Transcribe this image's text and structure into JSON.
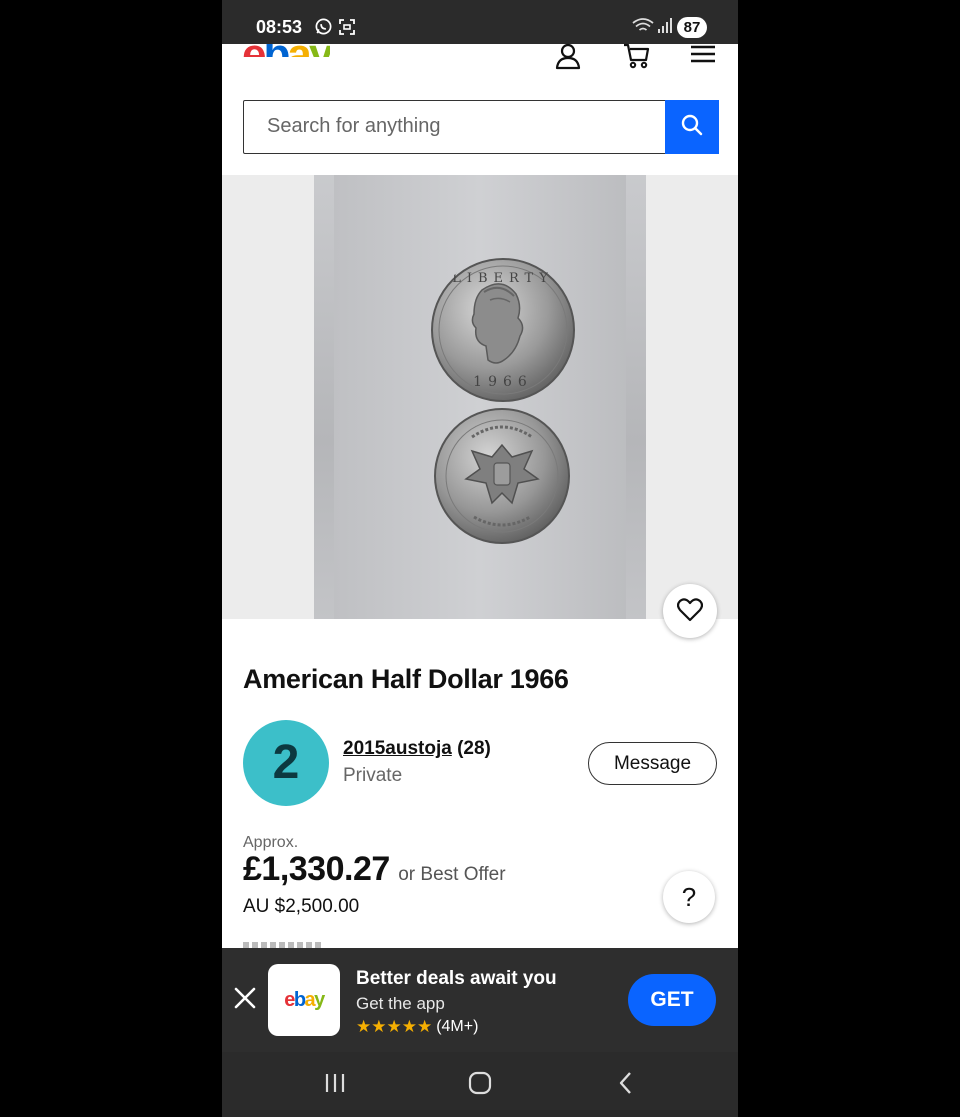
{
  "status_bar": {
    "time": "08:53",
    "battery": "87"
  },
  "header": {
    "logo": [
      "e",
      "b",
      "a",
      "y"
    ],
    "logo_colors": [
      "#e53238",
      "#0064d2",
      "#f5af02",
      "#86b817"
    ]
  },
  "search": {
    "placeholder": "Search for anything"
  },
  "item": {
    "title": "American Half Dollar 1966"
  },
  "seller": {
    "avatar_letter": "2",
    "name": "2015austoja",
    "feedback": "(28)",
    "type": "Private",
    "message_label": "Message"
  },
  "price": {
    "approx_label": "Approx.",
    "amount": "£1,330.27",
    "offer": "or Best Offer",
    "original": "AU $2,500.00",
    "help_label": "?"
  },
  "app_banner": {
    "app_icon_text": "ebay",
    "title": "Better deals await you",
    "subtitle": "Get the app",
    "stars": "★★★★★",
    "rating_count": "(4M+)",
    "get_label": "GET"
  },
  "colors": {
    "accent": "#0a64ff",
    "avatar": "#3cbfc9",
    "star": "#f5af02"
  },
  "icons": [
    "whatsapp-icon",
    "screenshot-icon",
    "wifi-icon",
    "signal-icon",
    "user-icon",
    "cart-icon",
    "menu-icon",
    "search-icon",
    "heart-icon",
    "close-icon",
    "nav-recents-icon",
    "nav-home-icon",
    "nav-back-icon"
  ]
}
